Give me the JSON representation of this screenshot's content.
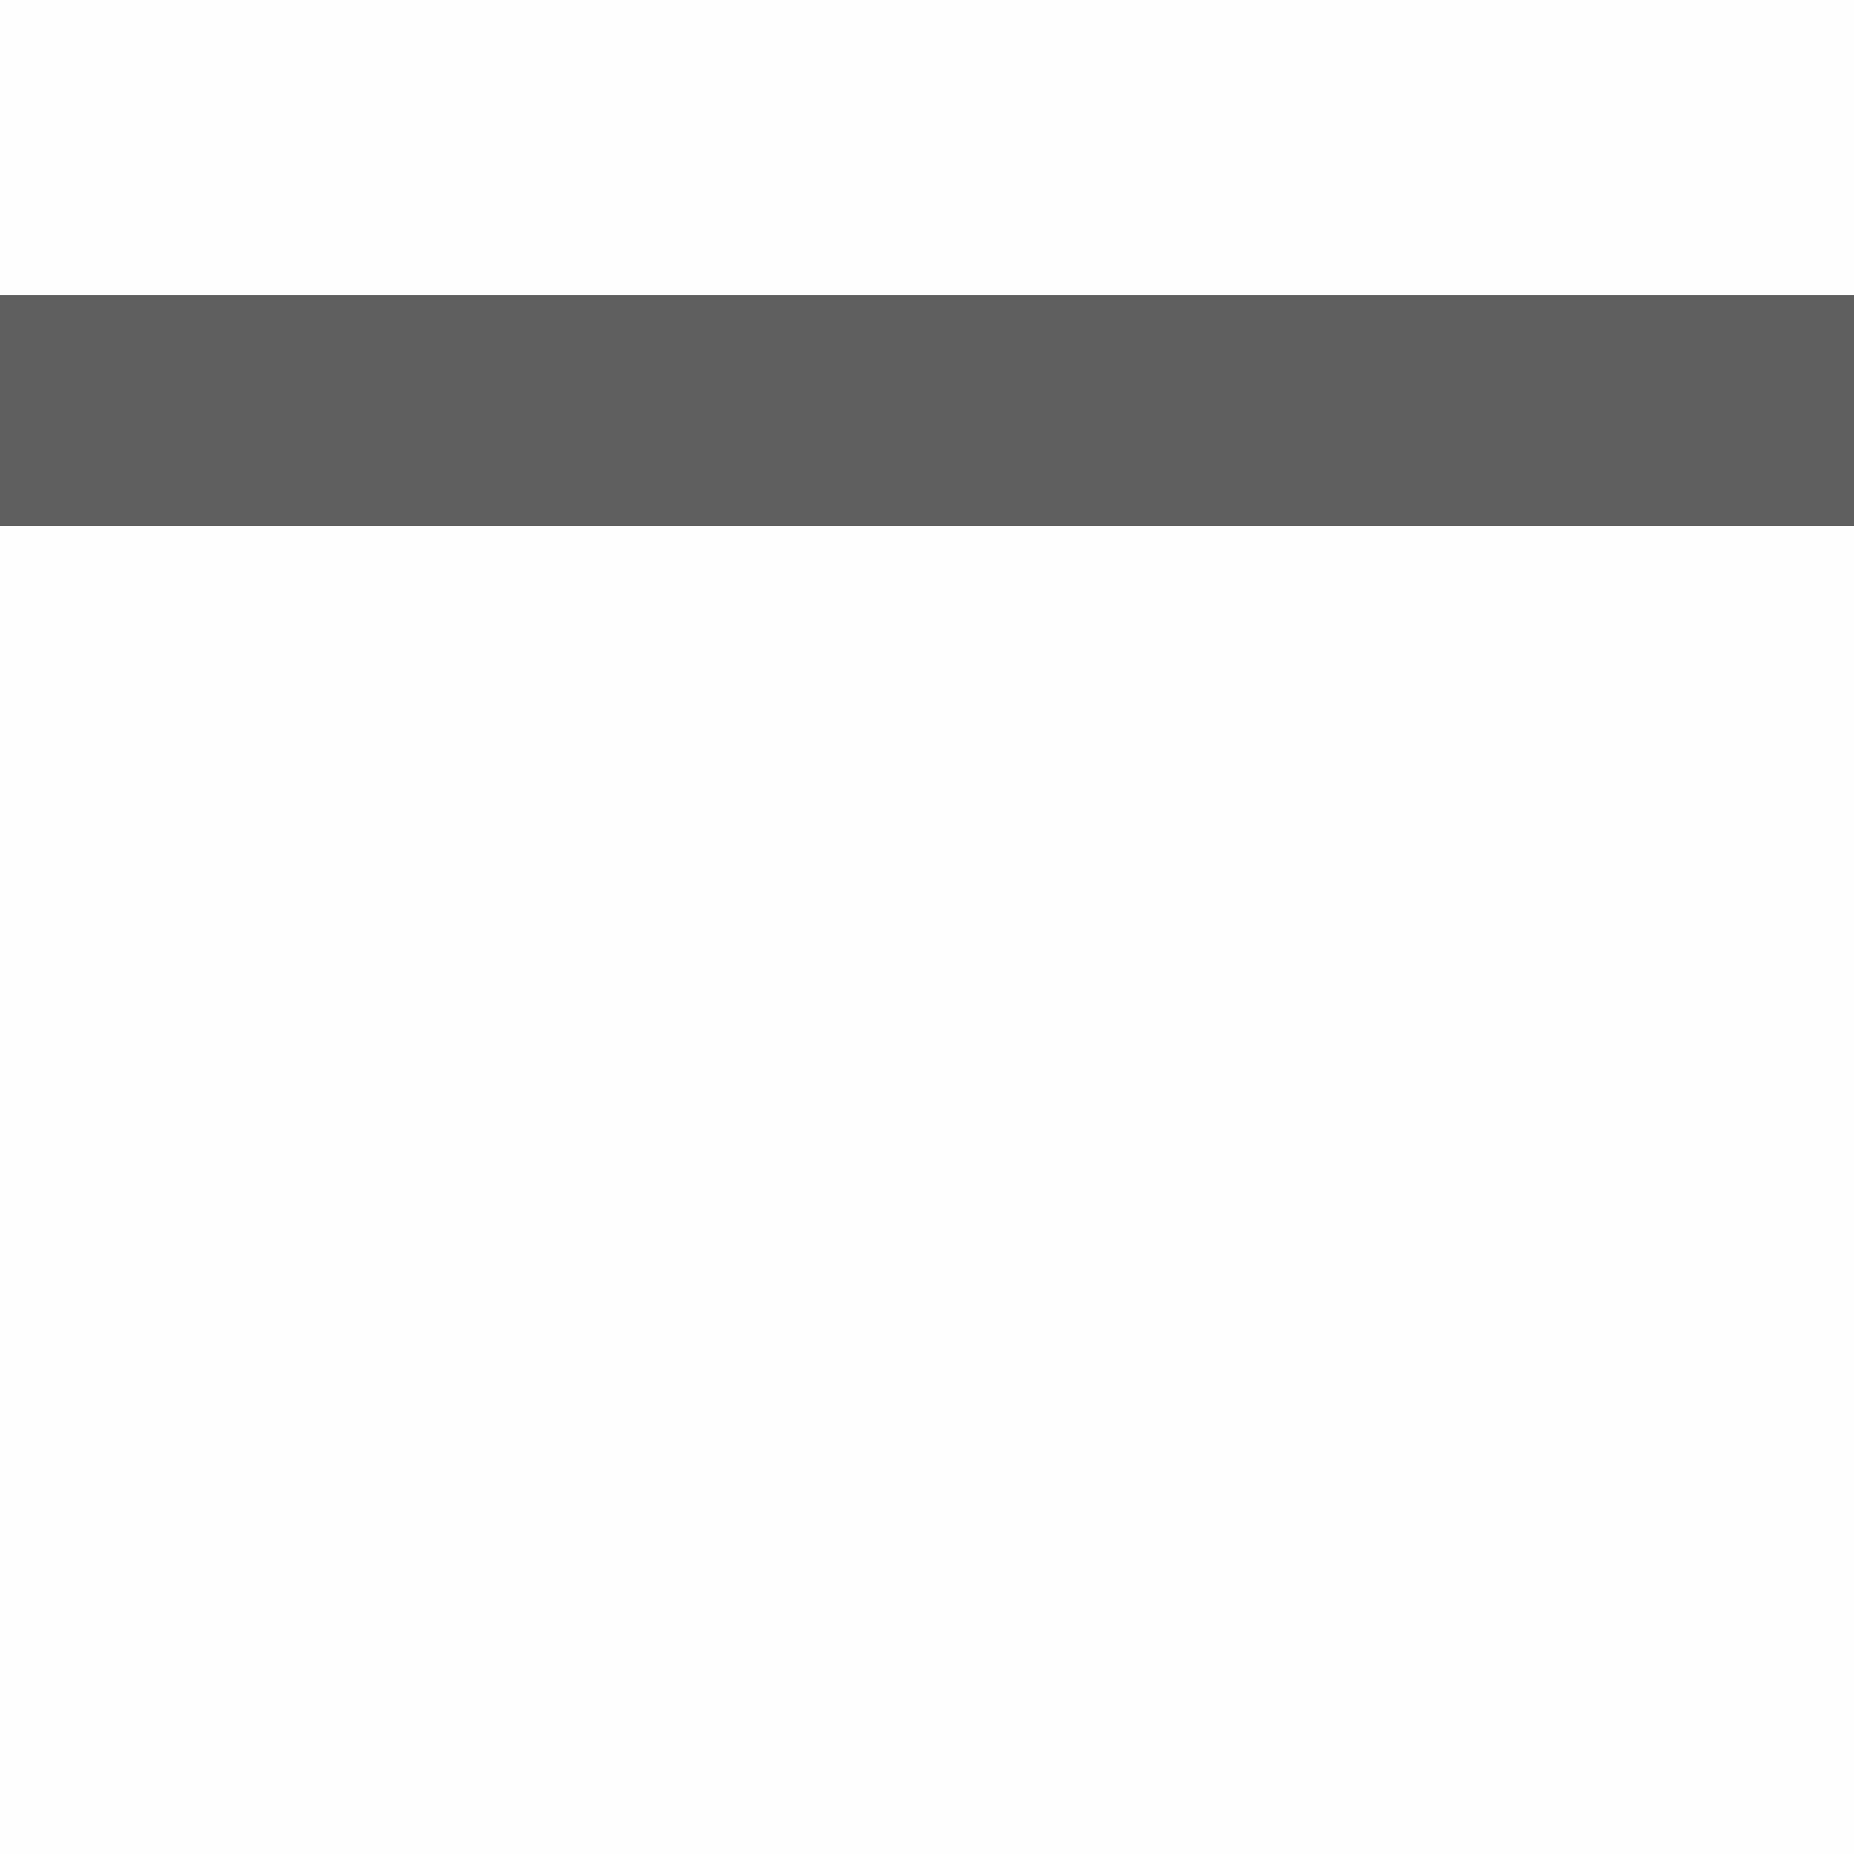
{
  "colors": {
    "background": "#fefefe",
    "bar": "#5f5f5f",
    "bar_border": "#555555"
  }
}
